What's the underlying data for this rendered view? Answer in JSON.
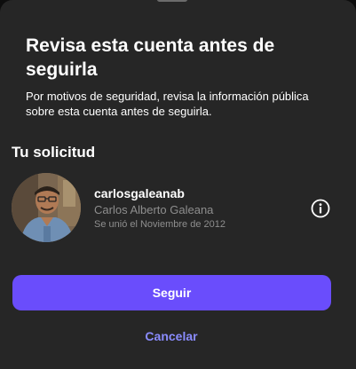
{
  "dialog": {
    "title": "Revisa esta cuenta antes de seguirla",
    "subtitle": "Por motivos de seguridad, revisa la información pública sobre esta cuenta antes de seguirla."
  },
  "request": {
    "heading": "Tu solicitud",
    "username": "carlosgaleanab",
    "full_name": "Carlos Alberto Galeana",
    "joined": "Se unió el Noviembre de 2012",
    "info_icon": "info-circle-icon"
  },
  "actions": {
    "follow_label": "Seguir",
    "cancel_label": "Cancelar"
  },
  "colors": {
    "sheet_background": "#262626",
    "primary_button": "#6a4dfc",
    "link": "#8a8cff",
    "secondary_text": "#8e8e8e"
  }
}
